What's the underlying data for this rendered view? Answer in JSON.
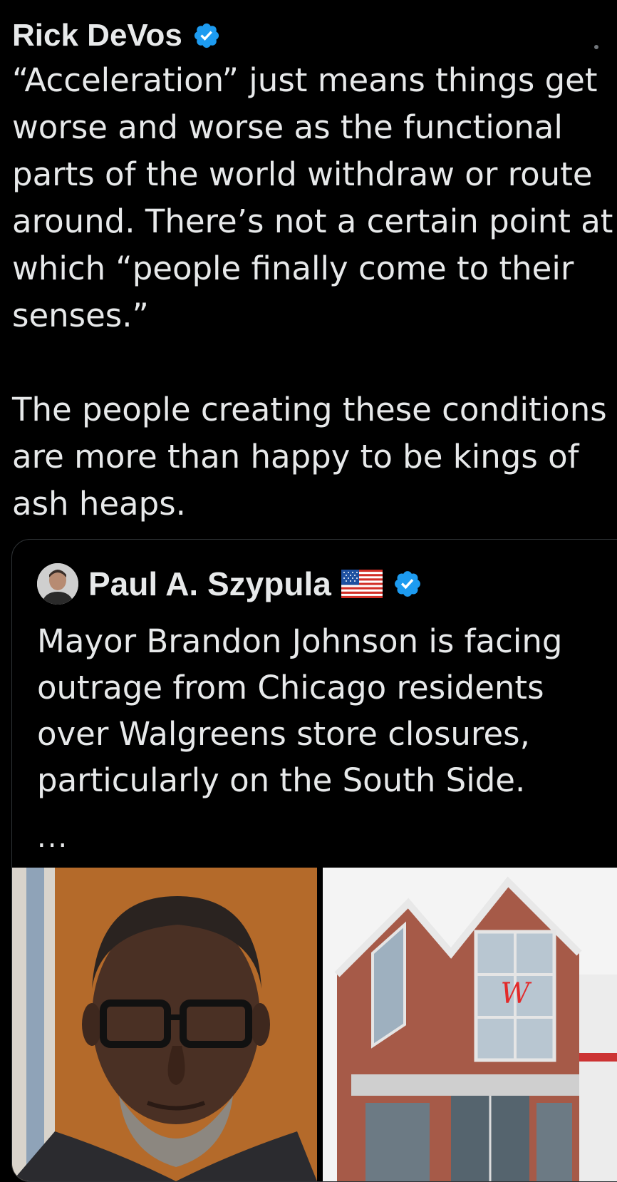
{
  "post": {
    "author_name": "Rick DeVos",
    "text": "“Acceleration” just means things get worse and worse as the functional parts of the world withdraw or route around. There’s not a certain point at which “people finally come to their senses.”\n\nThe people creating these conditions are more than happy to be kings of ash heaps."
  },
  "quoted_post": {
    "author_name": "Paul A. Szypula",
    "flag_icon": "us-flag-icon",
    "text": "Mayor Brandon Johnson is facing outrage from Chicago residents over Walgreens store closures, particularly on the South Side.",
    "ellipsis": "..."
  },
  "colors": {
    "background": "#000000",
    "text": "#e7e9ea",
    "verified_blue": "#1d9bf0",
    "border": "#2f3336"
  },
  "icons": {
    "verified": "verified-badge-icon",
    "more": "more-dot-icon"
  }
}
